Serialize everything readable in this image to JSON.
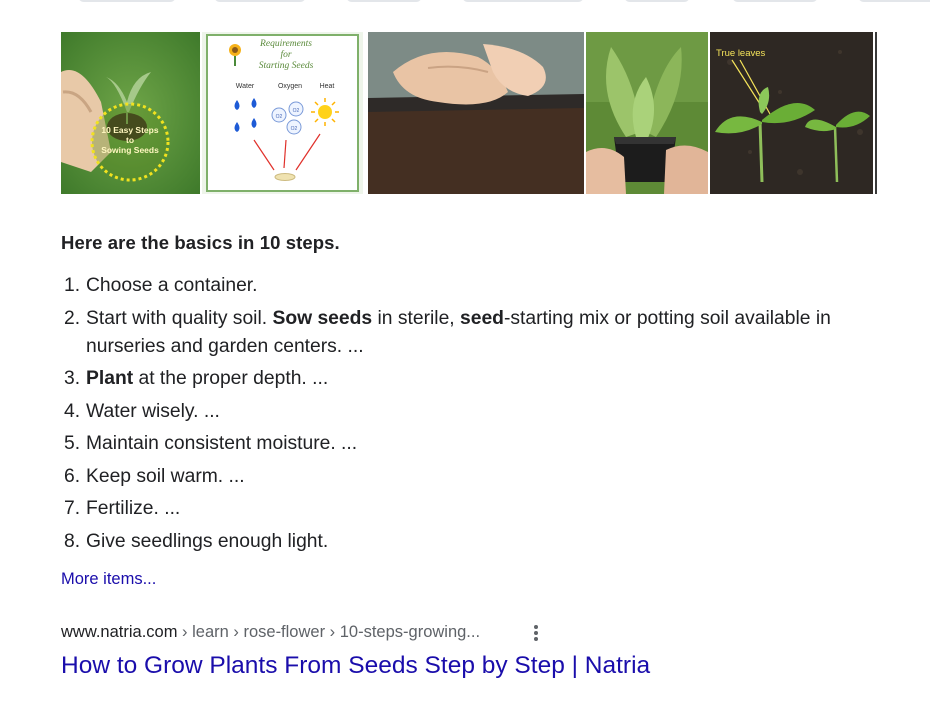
{
  "images": [
    {
      "alt": "10 Easy Steps to Sowing Seeds",
      "overlay_lines": [
        "10 Easy Steps",
        "to",
        "Sowing Seeds"
      ]
    },
    {
      "alt": "Requirements for Starting Seeds",
      "title_lines": [
        "Requirements",
        "for",
        "Starting Seeds"
      ],
      "labels": [
        "Water",
        "Oxygen",
        "Heat"
      ],
      "bubbles": [
        "O2",
        "O2",
        "O2"
      ]
    },
    {
      "alt": "Hands sowing seeds into soil tray"
    },
    {
      "alt": "Seedling in a black pot"
    },
    {
      "alt": "Seedlings with true leaves",
      "caption": "True leaves"
    },
    {
      "alt": "More image"
    }
  ],
  "featured": {
    "heading": "Here are the basics in 10 steps.",
    "steps": [
      {
        "num": "1.",
        "parts": [
          {
            "t": "Choose a container.",
            "b": false
          }
        ]
      },
      {
        "num": "2.",
        "parts": [
          {
            "t": "Start with quality soil. ",
            "b": false
          },
          {
            "t": "Sow seeds",
            "b": true
          },
          {
            "t": " in sterile, ",
            "b": false
          },
          {
            "t": "seed",
            "b": true
          },
          {
            "t": "-starting mix or potting soil available in nurseries and garden centers. ...",
            "b": false
          }
        ]
      },
      {
        "num": "3.",
        "parts": [
          {
            "t": "Plant",
            "b": true
          },
          {
            "t": " at the proper depth. ...",
            "b": false
          }
        ]
      },
      {
        "num": "4.",
        "parts": [
          {
            "t": "Water wisely. ...",
            "b": false
          }
        ]
      },
      {
        "num": "5.",
        "parts": [
          {
            "t": "Maintain consistent moisture. ...",
            "b": false
          }
        ]
      },
      {
        "num": "6.",
        "parts": [
          {
            "t": "Keep soil warm. ...",
            "b": false
          }
        ]
      },
      {
        "num": "7.",
        "parts": [
          {
            "t": "Fertilize. ...",
            "b": false
          }
        ]
      },
      {
        "num": "8.",
        "parts": [
          {
            "t": "Give seedlings enough light.",
            "b": false
          }
        ]
      }
    ],
    "more_label": "More items..."
  },
  "source": {
    "domain": "www.natria.com",
    "path": " › learn › rose-flower › 10-steps-growing...",
    "title": "How to Grow Plants From Seeds Step by Step | Natria"
  },
  "colors": {
    "link": "#1a0dab",
    "text": "#202124",
    "muted": "#5f6368"
  }
}
